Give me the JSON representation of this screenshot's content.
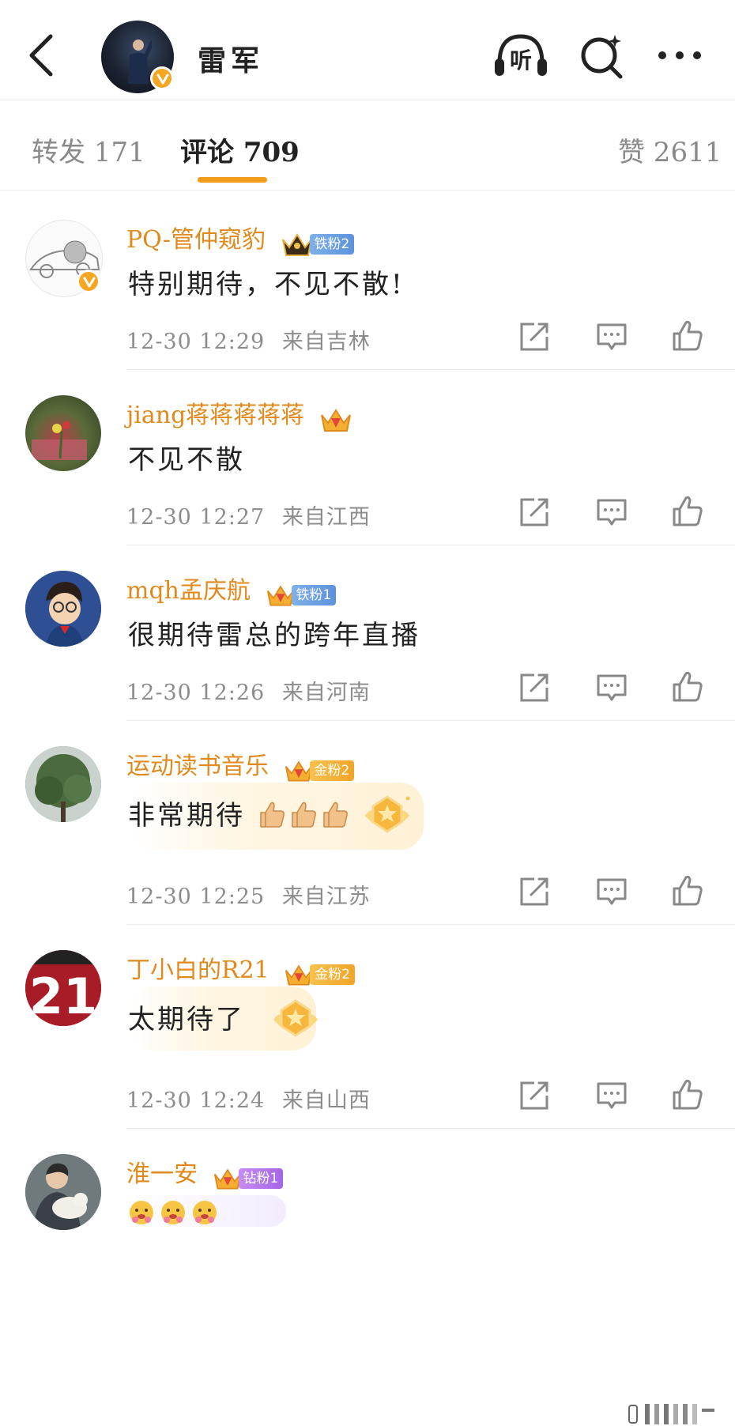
{
  "header": {
    "title": "雷军",
    "listen_icon_text": "听",
    "icons": [
      "back-arrow-icon",
      "listen-headphones-icon",
      "search-sparkle-icon",
      "more-dots-icon"
    ]
  },
  "tabs": {
    "repost": "转发 171",
    "comment": "评论 709",
    "like": "赞 2611",
    "accent_color": "#f39b1a"
  },
  "comments": [
    {
      "user": "PQ-管仲窥豹",
      "fan_badge": "铁粉2",
      "verified": true,
      "text": "特别期待，不见不散!",
      "time": "12-30 12:29",
      "location": "来自吉林"
    },
    {
      "user": "jiang蒋蒋蒋蒋蒋",
      "fan_badge": "",
      "text": "不见不散",
      "time": "12-30 12:27",
      "location": "来自江西"
    },
    {
      "user": "mqh孟庆航",
      "fan_badge": "铁粉1",
      "text": "很期待雷总的跨年直播",
      "time": "12-30 12:26",
      "location": "来自河南"
    },
    {
      "user": "运动读书音乐",
      "fan_badge": "金粉2",
      "text": "非常期待",
      "emoji": [
        "thumbs-up-icon",
        "thumbs-up-icon",
        "thumbs-up-icon"
      ],
      "time": "12-30 12:25",
      "location": "来自江苏"
    },
    {
      "user": "丁小白的R21",
      "fan_badge": "金粉2",
      "text": "太期待了",
      "avatar_text": "21",
      "time": "12-30 12:24",
      "location": "来自山西"
    },
    {
      "user": "淮一安",
      "fan_badge": "钻粉1",
      "text": "",
      "emoji": [
        "flower-face-icon",
        "flower-face-icon",
        "flower-face-icon"
      ]
    }
  ],
  "colors": {
    "username": "#e08a1e",
    "meta": "#8c8c8c",
    "iron_fan": "#6a9ee0",
    "gold_fan": "#f4ae30",
    "diamond_fan": "#b277ea"
  }
}
